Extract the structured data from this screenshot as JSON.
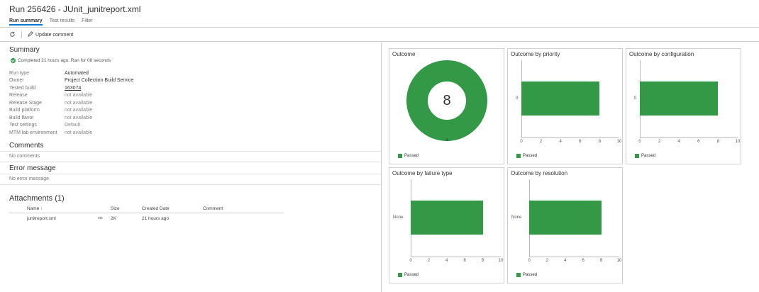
{
  "header": {
    "title": "Run 256426 - JUnit_junitreport.xml",
    "tabs": [
      {
        "label": "Run summary",
        "active": true
      },
      {
        "label": "Test results",
        "active": false
      },
      {
        "label": "Filter",
        "active": false
      }
    ]
  },
  "toolbar": {
    "refresh_icon": "refresh-icon",
    "update_comment_label": "Update comment",
    "edit_icon": "pencil-icon"
  },
  "summary": {
    "title": "Summary",
    "status_text": "Completed 21 hours ago. Ran for 08 seconds",
    "fields": [
      {
        "key": "Run type",
        "value": "Automated"
      },
      {
        "key": "Owner",
        "value": "Project Collection Build Service"
      },
      {
        "key": "Tested build",
        "value": "163074"
      },
      {
        "key": "Release",
        "value": "not available"
      },
      {
        "key": "Release Stage",
        "value": "not available"
      },
      {
        "key": "Build platform",
        "value": "not available"
      },
      {
        "key": "Build flavor",
        "value": "not available"
      },
      {
        "key": "Test settings",
        "value": "Default"
      },
      {
        "key": "MTM lab environment",
        "value": "not available"
      }
    ]
  },
  "comments": {
    "title": "Comments",
    "empty_text": "No comments"
  },
  "error_message": {
    "title": "Error message",
    "empty_text": "No error message"
  },
  "attachments": {
    "title": "Attachments (1)",
    "columns": {
      "name": "Name",
      "sort_indicator": "↑",
      "size": "Size",
      "created": "Created Date",
      "comment": "Comment"
    },
    "rows": [
      {
        "name": "junitreport.xml",
        "more": "•••",
        "size": "2K",
        "created": "21 hours ago",
        "comment": ""
      }
    ]
  },
  "colors": {
    "passed": "#339947",
    "accent": "#0078d4"
  },
  "legend_label": "Passed",
  "cards": {
    "outcome": {
      "title": "Outcome",
      "total": "8",
      "slice_label": "8"
    },
    "priority": {
      "title": "Outcome by priority",
      "category": "0"
    },
    "configuration": {
      "title": "Outcome by configuration",
      "category": "0"
    },
    "failure_type": {
      "title": "Outcome by failure type",
      "category": "None"
    },
    "resolution": {
      "title": "Outcome by resolution",
      "category": "None"
    }
  },
  "chart_data": [
    {
      "type": "pie",
      "title": "Outcome",
      "categories": [
        "Passed"
      ],
      "values": [
        8
      ],
      "center_label": "8"
    },
    {
      "type": "bar",
      "title": "Outcome by priority",
      "categories": [
        "0"
      ],
      "series": [
        {
          "name": "Passed",
          "values": [
            8
          ]
        }
      ],
      "xlim": [
        0,
        10
      ],
      "ticks": [
        0,
        2,
        4,
        6,
        8,
        10
      ]
    },
    {
      "type": "bar",
      "title": "Outcome by configuration",
      "categories": [
        "0"
      ],
      "series": [
        {
          "name": "Passed",
          "values": [
            8
          ]
        }
      ],
      "xlim": [
        0,
        10
      ],
      "ticks": [
        0,
        2,
        4,
        6,
        8,
        10
      ]
    },
    {
      "type": "bar",
      "title": "Outcome by failure type",
      "categories": [
        "None"
      ],
      "series": [
        {
          "name": "Passed",
          "values": [
            8
          ]
        }
      ],
      "xlim": [
        0,
        10
      ],
      "ticks": [
        0,
        2,
        4,
        6,
        8,
        10
      ]
    },
    {
      "type": "bar",
      "title": "Outcome by resolution",
      "categories": [
        "None"
      ],
      "series": [
        {
          "name": "Passed",
          "values": [
            8
          ]
        }
      ],
      "xlim": [
        0,
        10
      ],
      "ticks": [
        0,
        2,
        4,
        6,
        8,
        10
      ]
    }
  ]
}
